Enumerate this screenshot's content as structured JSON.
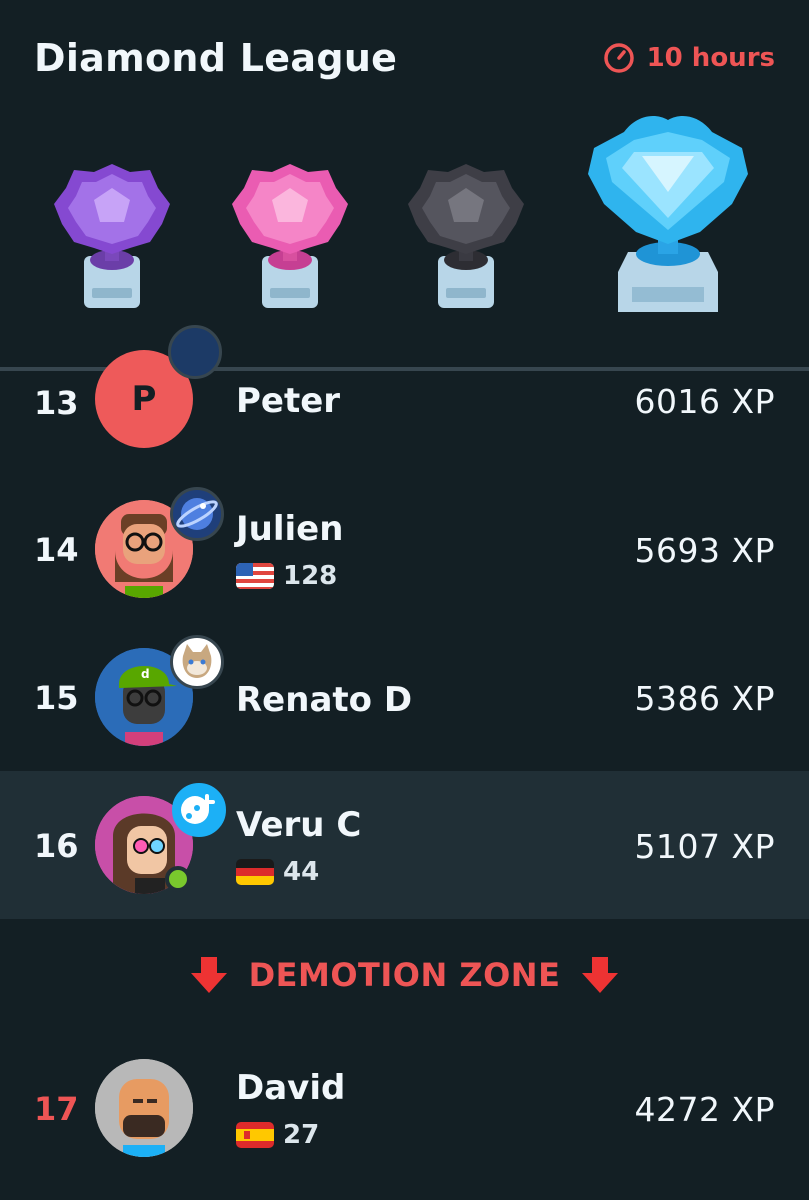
{
  "header": {
    "title": "Diamond League",
    "timer_label": "10 hours",
    "timer_icon": "clock-icon",
    "accent_color": "#ee5555"
  },
  "trophies": [
    {
      "name": "amethyst-trophy-icon",
      "color": "#9b5de5"
    },
    {
      "name": "pearl-trophy-icon",
      "color": "#f06bbf"
    },
    {
      "name": "obsidian-trophy-icon",
      "color": "#5a5a60"
    },
    {
      "name": "diamond-trophy-icon",
      "color": "#49c0f8"
    }
  ],
  "leaderboard": [
    {
      "rank": "13",
      "name": "Peter",
      "xp": "6016 XP",
      "avatar_letter": "P"
    },
    {
      "rank": "14",
      "name": "Julien",
      "xp": "5693 XP",
      "flag": "us-flag-icon",
      "streak": "128"
    },
    {
      "rank": "15",
      "name": "Renato D",
      "xp": "5386 XP"
    },
    {
      "rank": "16",
      "name": "Veru C",
      "xp": "5107 XP",
      "flag": "germany-flag-icon",
      "streak": "44"
    },
    {
      "rank": "17",
      "name": "David",
      "xp": "4272 XP",
      "flag": "spain-flag-icon",
      "streak": "27"
    }
  ],
  "demotion_zone": {
    "label": "DEMOTION ZONE",
    "icon": "arrow-down-icon"
  }
}
